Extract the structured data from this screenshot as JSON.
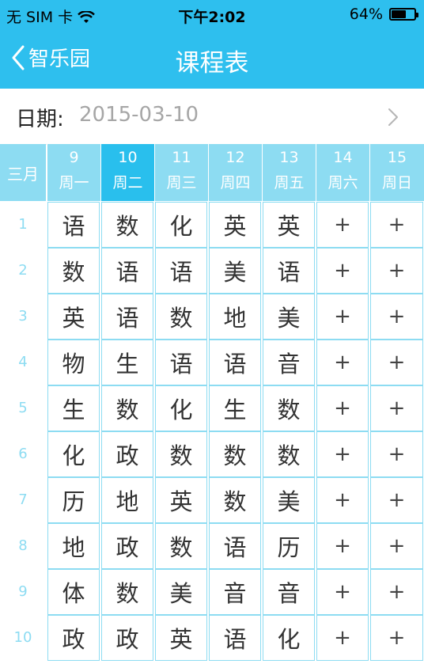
{
  "status_bar": {
    "carrier": "无 SIM 卡",
    "time": "下午2:02",
    "battery": "64%",
    "battery_level": 0.64
  },
  "nav": {
    "back_label": "智乐园",
    "title": "课程表"
  },
  "date": {
    "label": "日期:",
    "value": "2015-03-10"
  },
  "week": {
    "month": "三月",
    "days": [
      {
        "num": "9",
        "name": "周一"
      },
      {
        "num": "10",
        "name": "周二"
      },
      {
        "num": "11",
        "name": "周三"
      },
      {
        "num": "12",
        "name": "周四"
      },
      {
        "num": "13",
        "name": "周五"
      },
      {
        "num": "14",
        "name": "周六"
      },
      {
        "num": "15",
        "name": "周日"
      }
    ],
    "active_index": 1
  },
  "schedule": [
    {
      "period": "1",
      "cells": [
        "语",
        "数",
        "化",
        "英",
        "英",
        "+",
        "+"
      ]
    },
    {
      "period": "2",
      "cells": [
        "数",
        "语",
        "语",
        "美",
        "语",
        "+",
        "+"
      ]
    },
    {
      "period": "3",
      "cells": [
        "英",
        "语",
        "数",
        "地",
        "美",
        "+",
        "+"
      ]
    },
    {
      "period": "4",
      "cells": [
        "物",
        "生",
        "语",
        "语",
        "音",
        "+",
        "+"
      ]
    },
    {
      "period": "5",
      "cells": [
        "生",
        "数",
        "化",
        "生",
        "数",
        "+",
        "+"
      ]
    },
    {
      "period": "6",
      "cells": [
        "化",
        "政",
        "数",
        "数",
        "数",
        "+",
        "+"
      ]
    },
    {
      "period": "7",
      "cells": [
        "历",
        "地",
        "英",
        "数",
        "美",
        "+",
        "+"
      ]
    },
    {
      "period": "8",
      "cells": [
        "地",
        "政",
        "数",
        "语",
        "历",
        "+",
        "+"
      ]
    },
    {
      "period": "9",
      "cells": [
        "体",
        "数",
        "美",
        "音",
        "音",
        "+",
        "+"
      ]
    },
    {
      "period": "10",
      "cells": [
        "政",
        "政",
        "英",
        "语",
        "化",
        "+",
        "+"
      ]
    }
  ]
}
